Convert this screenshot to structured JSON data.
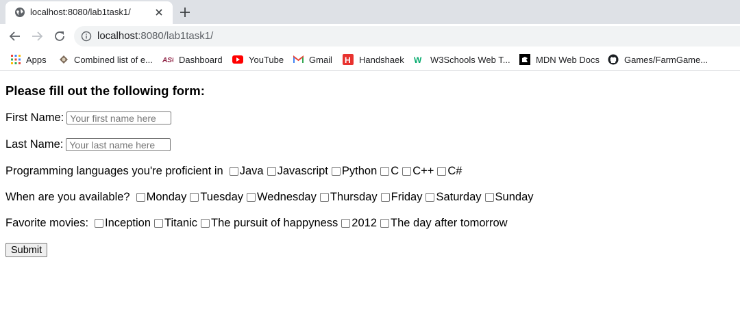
{
  "browser": {
    "tab_title": "localhost:8080/lab1task1/",
    "url_host": "localhost",
    "url_rest": ":8080/lab1task1/",
    "bookmarks": [
      {
        "label": "Apps",
        "icon": "apps-grid-icon"
      },
      {
        "label": "Combined list of e...",
        "icon": "asu-seal-icon"
      },
      {
        "label": "Dashboard",
        "icon": "asu-logo-icon"
      },
      {
        "label": "YouTube",
        "icon": "youtube-icon"
      },
      {
        "label": "Gmail",
        "icon": "gmail-icon"
      },
      {
        "label": "Handshaek",
        "icon": "handshake-icon"
      },
      {
        "label": "W3Schools Web T...",
        "icon": "w3schools-icon"
      },
      {
        "label": "MDN Web Docs",
        "icon": "mdn-icon"
      },
      {
        "label": "Games/FarmGame...",
        "icon": "github-icon"
      }
    ]
  },
  "form": {
    "title": "Please fill out the following form:",
    "first_name_label": "First Name:",
    "first_name_placeholder": "Your first name here",
    "last_name_label": "Last Name:",
    "last_name_placeholder": "Your last name here",
    "languages_label": "Programming languages you're proficient in",
    "languages": [
      "Java",
      "Javascript",
      "Python",
      "C",
      "C++",
      "C#"
    ],
    "availability_label": "When are you available?",
    "days": [
      "Monday",
      "Tuesday",
      "Wednesday",
      "Thursday",
      "Friday",
      "Saturday",
      "Sunday"
    ],
    "movies_label": "Favorite movies:",
    "movies": [
      "Inception",
      "Titanic",
      "The pursuit of happyness",
      "2012",
      "The day after tomorrow"
    ],
    "submit_label": "Submit"
  },
  "colors": {
    "tabstrip_bg": "#dee1e6",
    "omnibox_bg": "#f1f3f4",
    "youtube_red": "#ff0000",
    "w3schools_green": "#04aa6d",
    "handshake_red": "#e8322f"
  }
}
